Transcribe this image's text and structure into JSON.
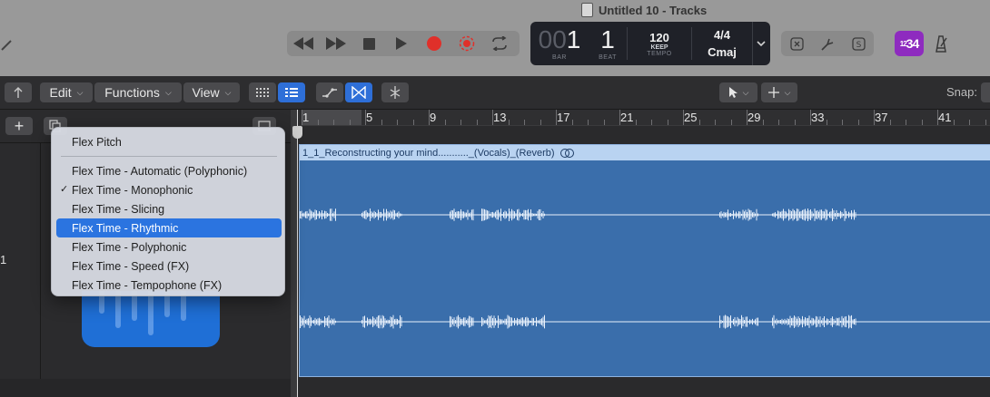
{
  "window": {
    "title": "Untitled 10 - Tracks"
  },
  "lcd": {
    "bar_dim": "00",
    "bar": "1",
    "beat": "1",
    "bar_label": "BAR",
    "beat_label": "BEAT",
    "tempo": "120",
    "tempo_mode": "KEEP",
    "tempo_label": "TEMPO",
    "time_signature": "4/4",
    "key": "Cmaj"
  },
  "counter_badge": {
    "main": "34",
    "sup": "12"
  },
  "toolbar": {
    "edit_label": "Edit",
    "functions_label": "Functions",
    "view_label": "View",
    "snap_label": "Snap:"
  },
  "track": {
    "number": "1"
  },
  "ruler": {
    "bars": [
      "1",
      "5",
      "9",
      "13",
      "17",
      "21",
      "25",
      "29",
      "33",
      "37",
      "41"
    ]
  },
  "region": {
    "name": "1_1_Reconstructing your mind..........._(Vocals)_(Reverb)"
  },
  "flex_menu": {
    "items": [
      {
        "label": "Flex Pitch",
        "checked": false,
        "selected": false
      },
      {
        "label": "Flex Time - Automatic (Polyphonic)",
        "checked": false,
        "selected": false
      },
      {
        "label": "Flex Time - Monophonic",
        "checked": true,
        "selected": false
      },
      {
        "label": "Flex Time - Slicing",
        "checked": false,
        "selected": false
      },
      {
        "label": "Flex Time - Rhythmic",
        "checked": false,
        "selected": true
      },
      {
        "label": "Flex Time - Polyphonic",
        "checked": false,
        "selected": false
      },
      {
        "label": "Flex Time - Speed (FX)",
        "checked": false,
        "selected": false
      },
      {
        "label": "Flex Time - Tempophone (FX)",
        "checked": false,
        "selected": false
      }
    ]
  },
  "colors": {
    "region_body": "#3a6eab",
    "region_header": "#b9d3f1",
    "menu_highlight": "#2b74e0",
    "record": "#e0302a",
    "counter_badge": "#8e2bbf",
    "plugin_blue": "#1f6fd6"
  }
}
